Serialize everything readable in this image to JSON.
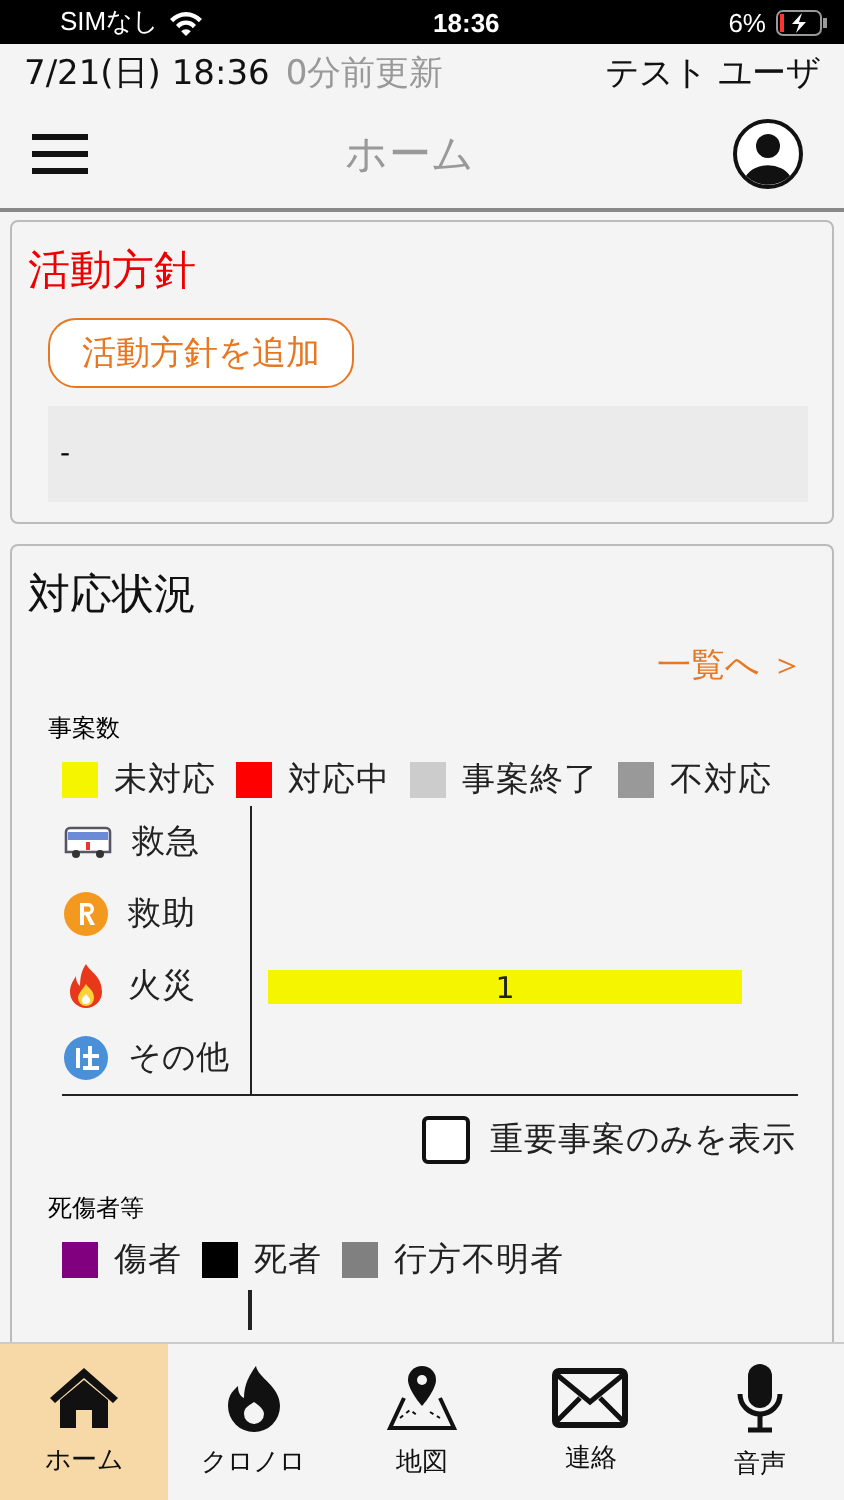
{
  "status_bar": {
    "carrier": "SIMなし",
    "time": "18:36",
    "battery": "6%"
  },
  "info_bar": {
    "datetime": "7/21(日) 18:36",
    "updated": "0分前更新",
    "user": "テスト ユーザ"
  },
  "nav": {
    "title": "ホーム"
  },
  "policy": {
    "title": "活動方針",
    "add_button": "活動方針を追加",
    "content": "-"
  },
  "status": {
    "title": "対応状況",
    "list_link": "一覧へ ＞",
    "incidents": {
      "label": "事案数",
      "chart_data": {
        "type": "bar",
        "orientation": "horizontal",
        "stacked": true,
        "data_labels": true,
        "categories": [
          "救急",
          "救助",
          "火災",
          "その他"
        ],
        "series": [
          {
            "name": "未対応",
            "color": "#f5f500",
            "values": [
              null,
              null,
              1,
              null
            ]
          },
          {
            "name": "対応中",
            "color": "#ff0000",
            "values": [
              null,
              null,
              null,
              null
            ]
          },
          {
            "name": "事案終了",
            "color": "#cccccc",
            "values": [
              null,
              null,
              null,
              null
            ]
          },
          {
            "name": "不対応",
            "color": "#999999",
            "values": [
              null,
              null,
              null,
              null
            ]
          }
        ]
      }
    },
    "important_only": {
      "label": "重要事案のみを表示",
      "checked": false
    },
    "casualties": {
      "label": "死傷者等",
      "legend": [
        {
          "label": "傷者",
          "color": "#800080"
        },
        {
          "label": "死者",
          "color": "#000000"
        },
        {
          "label": "行方不明者",
          "color": "#808080"
        }
      ]
    }
  },
  "tabs": [
    {
      "label": "ホーム",
      "selected": true
    },
    {
      "label": "クロノロ",
      "selected": false
    },
    {
      "label": "地図",
      "selected": false
    },
    {
      "label": "連絡",
      "selected": false
    },
    {
      "label": "音声",
      "selected": false
    }
  ]
}
